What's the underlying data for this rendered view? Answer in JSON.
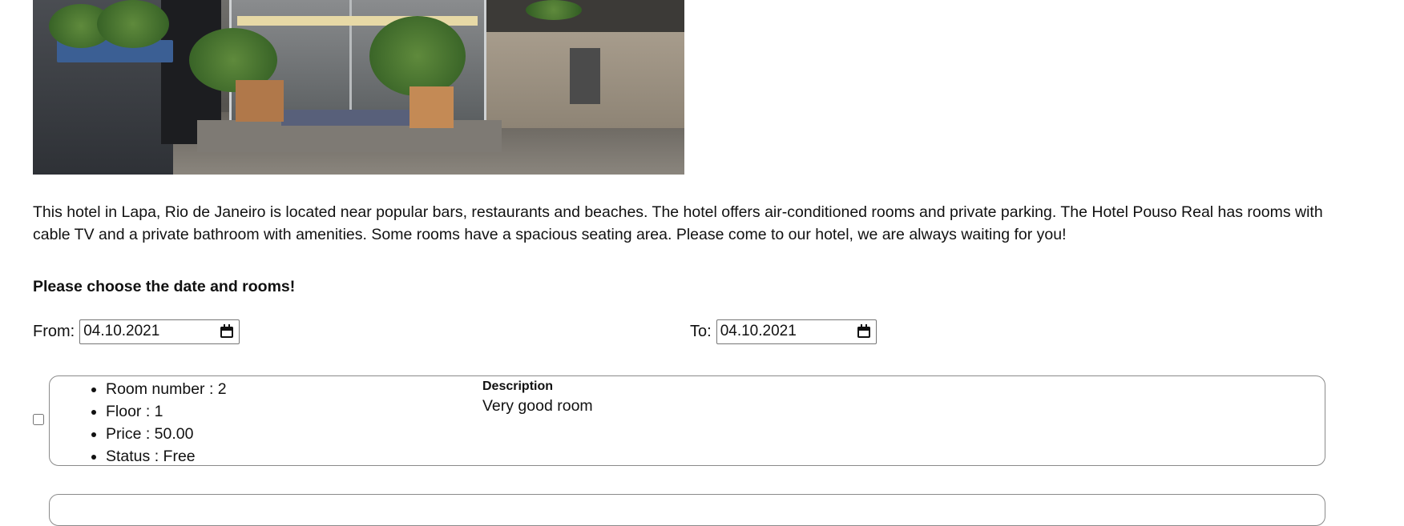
{
  "hotel": {
    "description": "This hotel in Lapa, Rio de Janeiro is located near popular bars, restaurants and beaches. The hotel offers air-conditioned rooms and private parking. The Hotel Pouso Real has rooms with cable TV and a private bathroom with amenities. Some rooms have a spacious seating area. Please come to our hotel, we are always waiting for you!"
  },
  "booking": {
    "heading": "Please choose the date and rooms!",
    "from_label": "From:",
    "from_value": "04.10.2021",
    "to_label": "To:",
    "to_value": "04.10.2021"
  },
  "rooms": [
    {
      "number_text": "Room number : 2",
      "floor_text": "Floor : 1",
      "price_text": "Price : 50.00",
      "status_text": "Status : Free",
      "description_title": "Description",
      "description": "Very good room",
      "selected": false
    }
  ],
  "icons": {
    "date_picker": "calendar-icon"
  }
}
